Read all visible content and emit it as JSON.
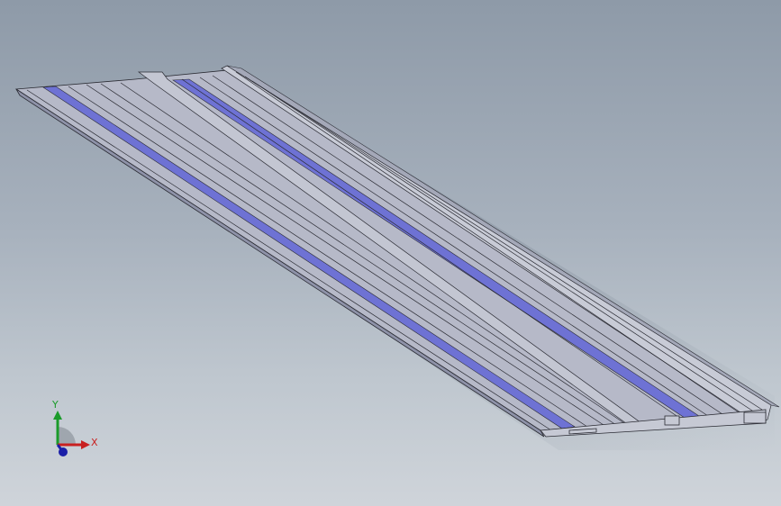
{
  "viewport": {
    "background_top": "#8e9aa8",
    "background_bottom": "#cfd4da"
  },
  "model": {
    "face_color": "#b6b9c8",
    "edge_color": "#2a2b33",
    "stripe_color": "#6e72d4"
  },
  "triad": {
    "y_label": "Y",
    "x_label": "X",
    "y_color": "#1a9b2a",
    "x_color": "#c82020",
    "z_color": "#1a1fa8"
  }
}
